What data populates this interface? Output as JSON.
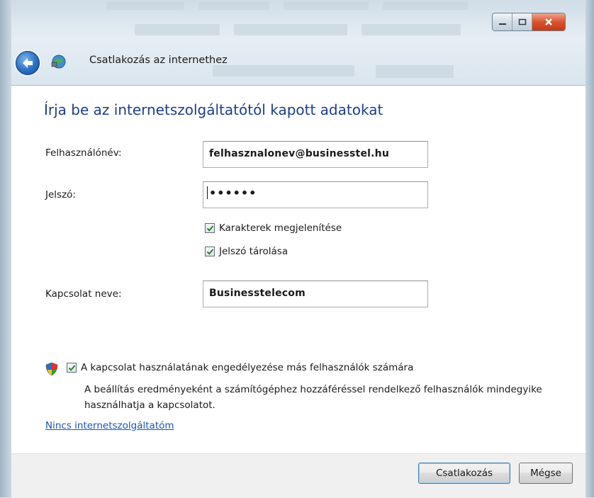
{
  "window": {
    "title": "Csatlakozás az internethez",
    "controls": {
      "minimize_icon": "minimize-icon",
      "maximize_icon": "maximize-icon",
      "close_icon": "close-icon"
    }
  },
  "nav": {
    "back_icon": "back-arrow-icon",
    "app_icon": "network-globe-icon"
  },
  "form": {
    "heading": "Írja be az internetszolgáltatótól kapott adatokat",
    "username": {
      "label": "Felhasználónév:",
      "value": "felhasznalonev@businesstel.hu"
    },
    "password": {
      "label": "Jelszó:",
      "value": "••••••"
    },
    "show_chars": {
      "label": "Karakterek megjelenítése",
      "checked": true
    },
    "save_password": {
      "label": "Jelszó tárolása",
      "checked": true
    },
    "connection_name": {
      "label": "Kapcsolat neve:",
      "value": "Businesstelecom"
    }
  },
  "share": {
    "icon": "uac-shield-icon",
    "label": "A kapcsolat használatának engedélyezése más felhasználók számára",
    "checked": true,
    "description": "A beállítás eredményeként a számítógéphez hozzáféréssel rendelkező felhasználók mindegyike használhatja a kapcsolatot."
  },
  "link": {
    "label": "Nincs internetszolgáltatóm"
  },
  "buttons": {
    "connect": "Csatlakozás",
    "cancel": "Mégse"
  },
  "colors": {
    "heading": "#1e3f87",
    "link": "#1a55b4",
    "close_button": "#c23a18"
  }
}
